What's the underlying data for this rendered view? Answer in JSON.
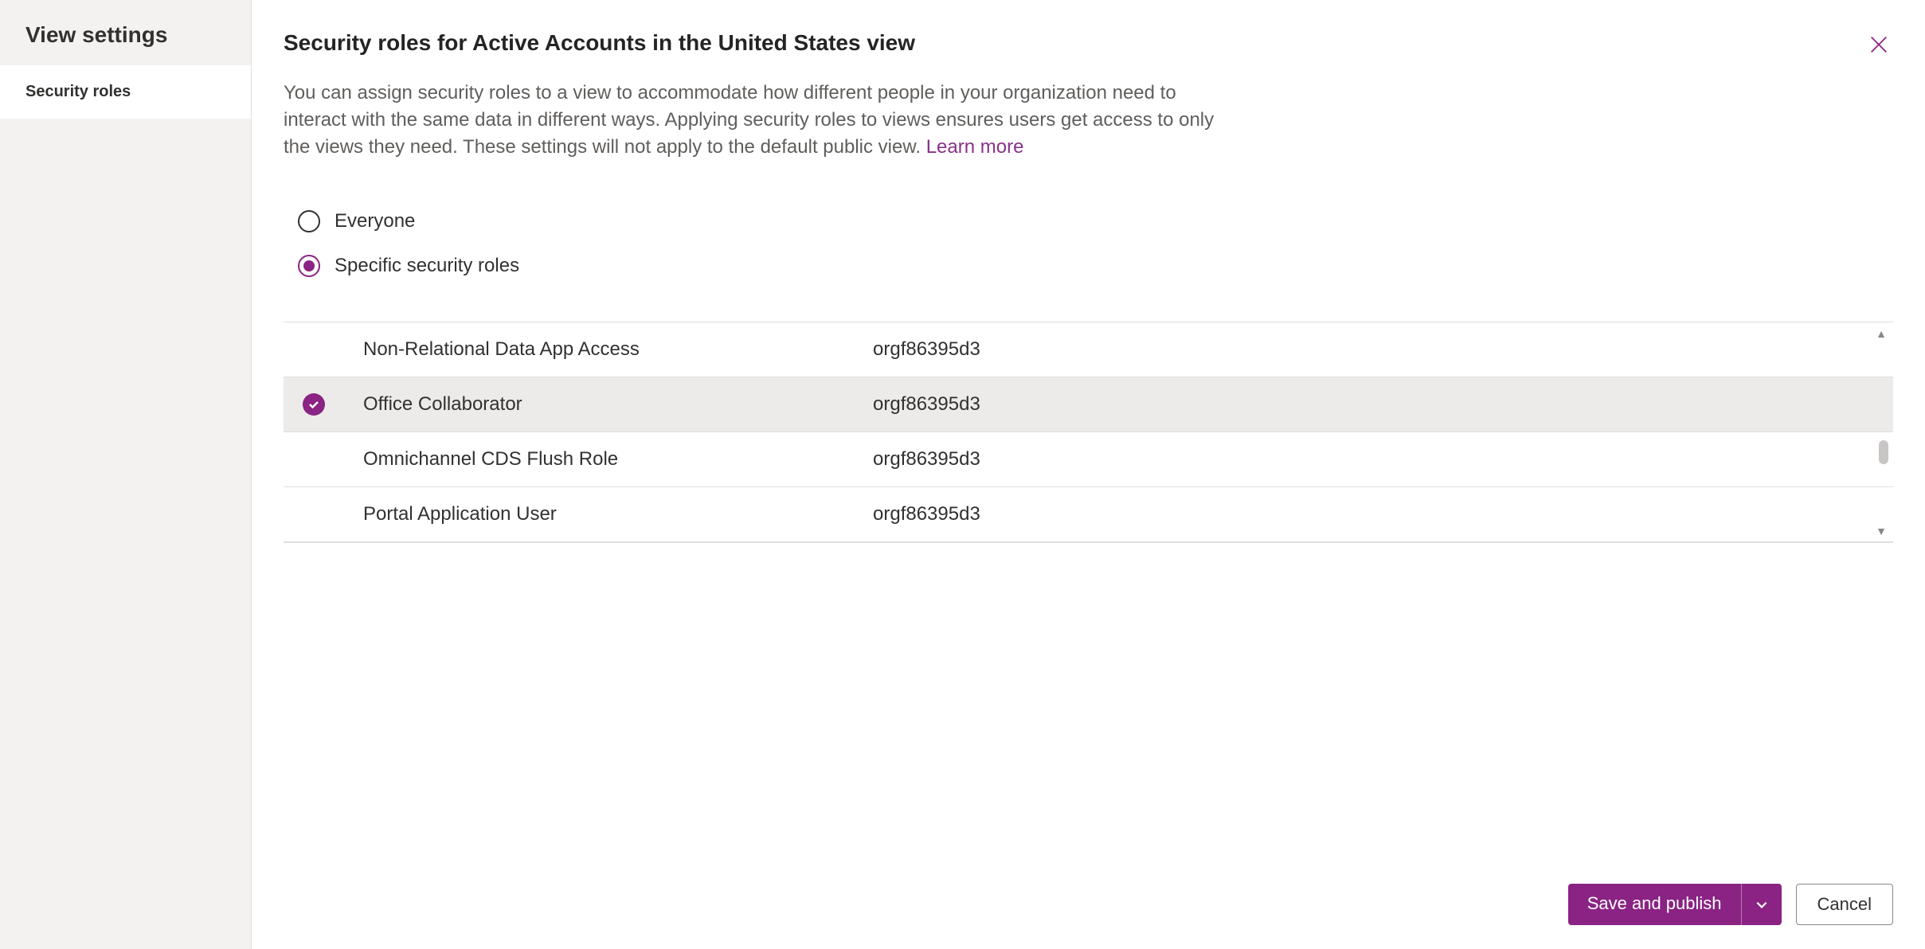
{
  "sidebar": {
    "title": "View settings",
    "items": [
      {
        "label": "Security roles"
      }
    ]
  },
  "main": {
    "title": "Security roles for Active Accounts in the United States view",
    "description": "You can assign security roles to a view to accommodate how different people in your organization need to interact with the same data in different ways. Applying security roles to views ensures users get access to only the views they need. These settings will not apply to the default public view. ",
    "learn_more": "Learn more"
  },
  "radio": {
    "everyone": "Everyone",
    "specific": "Specific security roles",
    "selected": "specific"
  },
  "roles": [
    {
      "name": "Non-Relational Data App Access",
      "org": "orgf86395d3",
      "selected": false
    },
    {
      "name": "Office Collaborator",
      "org": "orgf86395d3",
      "selected": true
    },
    {
      "name": "Omnichannel CDS Flush Role",
      "org": "orgf86395d3",
      "selected": false
    },
    {
      "name": "Portal Application User",
      "org": "orgf86395d3",
      "selected": false
    }
  ],
  "footer": {
    "save": "Save and publish",
    "cancel": "Cancel"
  }
}
